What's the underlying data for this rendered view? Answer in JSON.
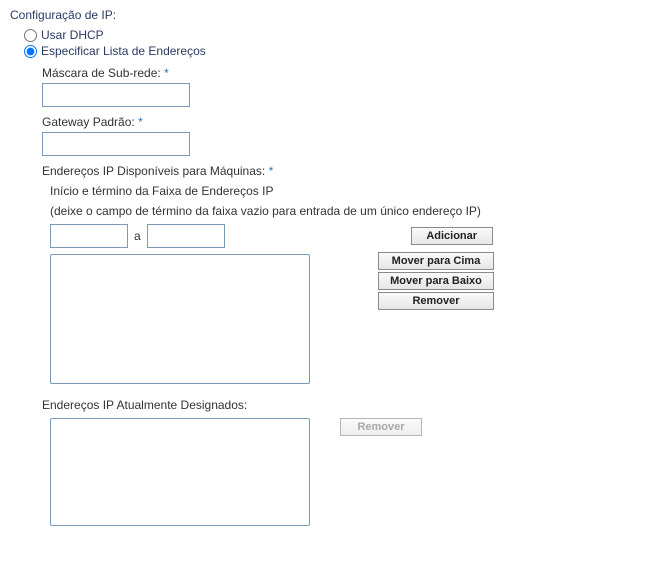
{
  "section_title": "Configuração de IP:",
  "radios": {
    "use_dhcp": "Usar DHCP",
    "specify_list": "Especificar Lista de Endereços",
    "selected": "specify_list"
  },
  "subnet": {
    "label": "Máscara de Sub-rede:",
    "asterisk": "*",
    "value": ""
  },
  "gateway": {
    "label": "Gateway Padrão:",
    "asterisk": "*",
    "value": ""
  },
  "available": {
    "label": "Endereços IP Disponíveis para Máquinas:",
    "asterisk": "*"
  },
  "range": {
    "heading": "Início e término da Faixa de Endereços IP",
    "hint": "(deixe o campo de término da faixa vazio para entrada de um único endereço IP)",
    "start": "",
    "end": "",
    "separator": "a"
  },
  "buttons": {
    "add": "Adicionar",
    "move_up": "Mover para Cima",
    "move_down": "Mover para Baixo",
    "remove": "Remover",
    "remove_assigned": "Remover"
  },
  "available_list": [],
  "assigned": {
    "label": "Endereços IP Atualmente Designados:"
  },
  "assigned_list": []
}
